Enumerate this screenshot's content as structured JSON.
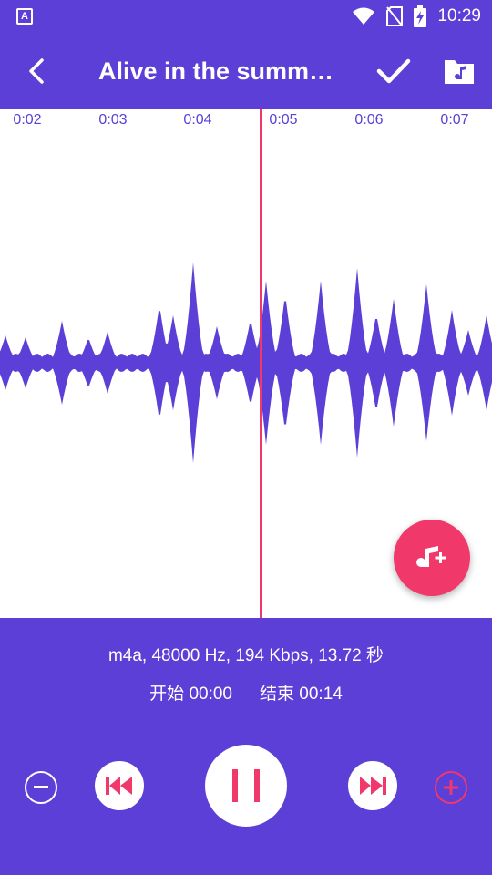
{
  "status_bar": {
    "time": "10:29",
    "app_icon_letter": "A"
  },
  "toolbar": {
    "title": "Alive in the summ…"
  },
  "timeline": {
    "ticks": [
      "0:02",
      "0:03",
      "0:04",
      "0:05",
      "0:06",
      "0:07"
    ]
  },
  "file_info": "m4a, 48000 Hz, 194 Kbps, 13.72 秒",
  "start_label": "开始 00:00",
  "end_label": "结束 00:14",
  "colors": {
    "primary": "#5b3fd6",
    "accent": "#f0386b",
    "white": "#ffffff"
  }
}
